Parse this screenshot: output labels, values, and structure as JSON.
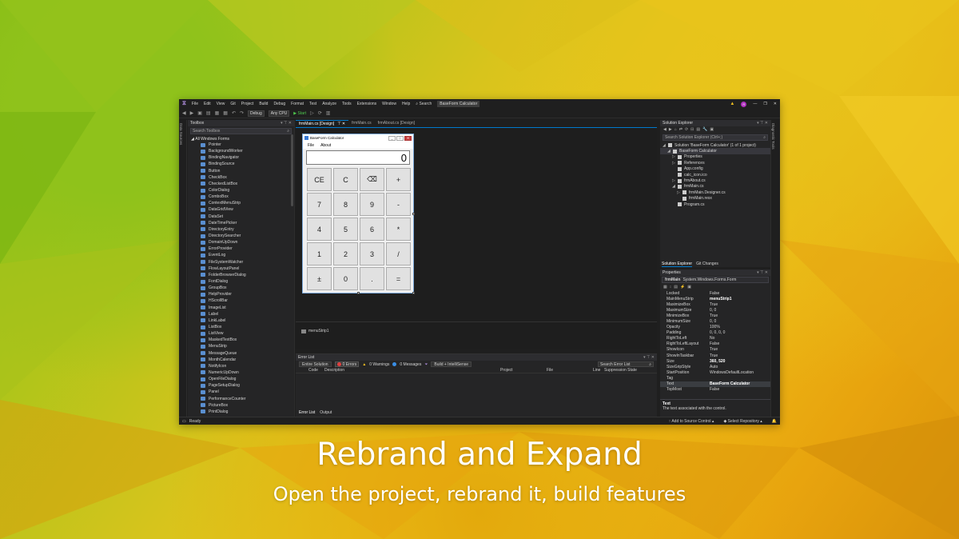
{
  "menubar": {
    "items": [
      "File",
      "Edit",
      "View",
      "Git",
      "Project",
      "Build",
      "Debug",
      "Format",
      "Test",
      "Analyze",
      "Tools",
      "Extensions",
      "Window",
      "Help"
    ],
    "search": "Search",
    "solution_name": "BaseForm Calculator",
    "avatar_initial": "R"
  },
  "toolbar": {
    "config": "Debug",
    "platform": "Any CPU",
    "start": "Start"
  },
  "left_strip": {
    "label": "Data Sources"
  },
  "right_strip": {
    "label": "Diagnostic Tools"
  },
  "toolbox": {
    "title": "Toolbox",
    "search_placeholder": "Search Toolbox",
    "group": "All Windows Forms",
    "items": [
      "Pointer",
      "BackgroundWorker",
      "BindingNavigator",
      "BindingSource",
      "Button",
      "CheckBox",
      "CheckedListBox",
      "ColorDialog",
      "ComboBox",
      "ContextMenuStrip",
      "DataGridView",
      "DataSet",
      "DateTimePicker",
      "DirectoryEntry",
      "DirectorySearcher",
      "DomainUpDown",
      "ErrorProvider",
      "EventLog",
      "FileSystemWatcher",
      "FlowLayoutPanel",
      "FolderBrowserDialog",
      "FontDialog",
      "GroupBox",
      "HelpProvider",
      "HScrollBar",
      "ImageList",
      "Label",
      "LinkLabel",
      "ListBox",
      "ListView",
      "MaskedTextBox",
      "MenuStrip",
      "MessageQueue",
      "MonthCalendar",
      "NotifyIcon",
      "NumericUpDown",
      "OpenFileDialog",
      "PageSetupDialog",
      "Panel",
      "PerformanceCounter",
      "PictureBox",
      "PrintDialog"
    ]
  },
  "tabs": [
    {
      "label": "frmMain.cs [Design]",
      "active": true
    },
    {
      "label": "frmMain.cs",
      "active": false
    },
    {
      "label": "frmAbout.cs [Design]",
      "active": false
    }
  ],
  "calculator": {
    "title": "BaseForm Calculator",
    "menu": [
      "File",
      "About"
    ],
    "display": "0",
    "keys": [
      "CE",
      "C",
      "⌫",
      "+",
      "7",
      "8",
      "9",
      "-",
      "4",
      "5",
      "6",
      "*",
      "1",
      "2",
      "3",
      "/",
      "±",
      "0",
      ".",
      "="
    ]
  },
  "component_tray": {
    "item": "menuStrip1"
  },
  "error_list": {
    "title": "Error List",
    "scope": "Entire Solution",
    "errors": "0 Errors",
    "warnings": "0 Warnings",
    "messages": "0 Messages",
    "build_filter": "Build + IntelliSense",
    "search_placeholder": "Search Error List",
    "columns": [
      "Code",
      "Description",
      "Project",
      "File",
      "Line",
      "Suppression State"
    ]
  },
  "bottom_tabs": [
    "Error List",
    "Output"
  ],
  "solution_explorer": {
    "title": "Solution Explorer",
    "search_placeholder": "Search Solution Explorer (Ctrl+;)",
    "nodes": [
      {
        "label": "Solution 'BaseForm Calculator' (1 of 1 project)",
        "indent": 0
      },
      {
        "label": "BaseForm Calculator",
        "indent": 1
      },
      {
        "label": "Properties",
        "indent": 2
      },
      {
        "label": "References",
        "indent": 2
      },
      {
        "label": "App.config",
        "indent": 2
      },
      {
        "label": "calc_icon.ico",
        "indent": 2
      },
      {
        "label": "frmAbout.cs",
        "indent": 2
      },
      {
        "label": "frmMain.cs",
        "indent": 2
      },
      {
        "label": "frmMain.Designer.cs",
        "indent": 3
      },
      {
        "label": "frmMain.resx",
        "indent": 3
      },
      {
        "label": "Program.cs",
        "indent": 2
      }
    ],
    "tabs": [
      "Solution Explorer",
      "Git Changes"
    ]
  },
  "properties": {
    "title": "Properties",
    "object": "frmMain",
    "object_type": "System.Windows.Forms.Form",
    "rows": [
      {
        "name": "Locked",
        "value": "False"
      },
      {
        "name": "MainMenuStrip",
        "value": "menuStrip1",
        "bold": true
      },
      {
        "name": "MaximizeBox",
        "value": "True"
      },
      {
        "name": "MaximumSize",
        "value": "0, 0"
      },
      {
        "name": "MinimizeBox",
        "value": "True"
      },
      {
        "name": "MinimumSize",
        "value": "0, 0"
      },
      {
        "name": "Opacity",
        "value": "100%"
      },
      {
        "name": "Padding",
        "value": "0, 0, 0, 0"
      },
      {
        "name": "RightToLeft",
        "value": "No"
      },
      {
        "name": "RightToLeftLayout",
        "value": "False"
      },
      {
        "name": "ShowIcon",
        "value": "True"
      },
      {
        "name": "ShowInTaskbar",
        "value": "True"
      },
      {
        "name": "Size",
        "value": "360, 520",
        "bold": true
      },
      {
        "name": "SizeGripStyle",
        "value": "Auto"
      },
      {
        "name": "StartPosition",
        "value": "WindowsDefaultLocation"
      },
      {
        "name": "Tag",
        "value": ""
      },
      {
        "name": "Text",
        "value": "BaseForm Calculator",
        "bold": true,
        "selected": true
      },
      {
        "name": "TopMost",
        "value": "False"
      }
    ],
    "desc_title": "Text",
    "desc_text": "The text associated with the control."
  },
  "statusbar": {
    "status": "Ready",
    "add_source": "Add to Source Control",
    "select_repo": "Select Repository"
  },
  "caption": {
    "title": "Rebrand and Expand",
    "subtitle": "Open the project, rebrand it, build features"
  },
  "colors": {
    "accent": "#007acc",
    "ide_bg": "#1f1f1f",
    "caption_text": "#ffffff"
  }
}
